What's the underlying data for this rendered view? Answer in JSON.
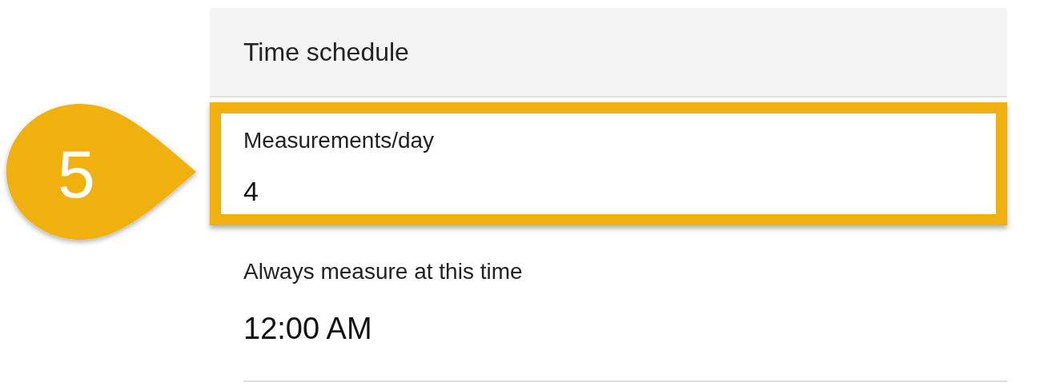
{
  "header": {
    "title": "Time schedule"
  },
  "settings": [
    {
      "label": "Measurements/day",
      "value": "4",
      "highlighted": true
    },
    {
      "label": "Always measure at this time",
      "value": "12:00 AM",
      "highlighted": false
    }
  ],
  "callout": {
    "number": "5"
  }
}
